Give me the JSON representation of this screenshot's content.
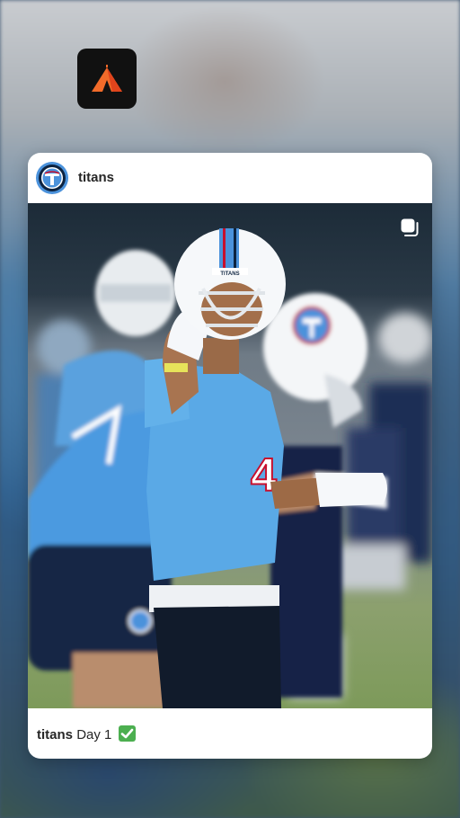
{
  "post": {
    "username": "titans",
    "caption_user": "titans",
    "caption_text": "Day 1",
    "caption_emoji_icon": "check-mark-emoji-icon"
  },
  "icons": {
    "app": "tent-app-icon",
    "avatar": "titans-logo-icon",
    "multiple_media": "carousel-icon"
  },
  "photo": {
    "helmet_text": "TITANS",
    "jersey_number": "4"
  },
  "colors": {
    "card_bg": "#ffffff",
    "text": "#262626",
    "titans_blue": "#4b92db",
    "titans_navy": "#0c2340",
    "titans_red": "#c8102e",
    "check_green": "#4caf50"
  }
}
